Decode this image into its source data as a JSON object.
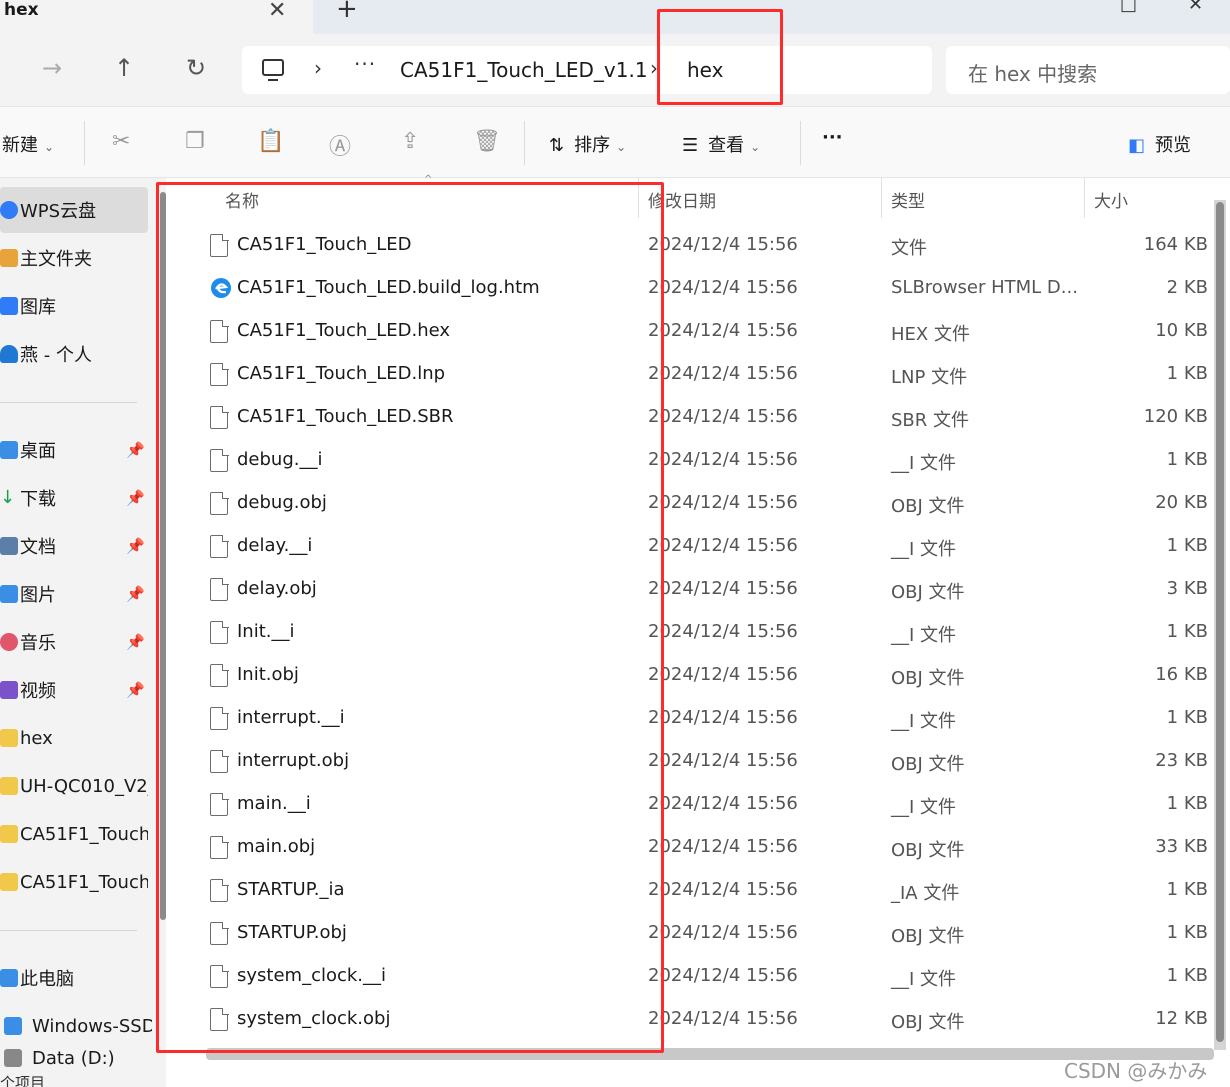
{
  "window": {
    "tab_title": "hex",
    "tab_close": "✕",
    "new_tab": "+",
    "minimize": "—",
    "close": "✕"
  },
  "nav": {
    "back": "←",
    "forward": "→",
    "up": "↑",
    "refresh": "↻"
  },
  "address": {
    "sep": "›",
    "more": "···",
    "segments": [
      "CA51F1_Touch_LED_v1.1",
      "hex"
    ]
  },
  "search": {
    "placeholder": "在 hex 中搜索"
  },
  "toolbar": {
    "new_label": "新建",
    "sort_label": "排序",
    "view_label": "查看",
    "more_label": "···",
    "preview_label": "预览"
  },
  "sidebar": {
    "items": [
      {
        "label": "WPS云盘",
        "icon": "wps-cloud-icon",
        "color": "#2f7cf6"
      },
      {
        "label": "主文件夹",
        "icon": "home-icon",
        "color": "#e8a33a"
      },
      {
        "label": "图库",
        "icon": "gallery-icon",
        "color": "#2f7cf6"
      },
      {
        "label": "燕 - 个人",
        "icon": "onedrive-icon",
        "color": "#1f78d1"
      },
      {
        "label": "桌面",
        "icon": "desktop-icon",
        "color": "#3a8ee6"
      },
      {
        "label": "下载",
        "icon": "download-icon",
        "color": "#17a34a"
      },
      {
        "label": "文档",
        "icon": "documents-icon",
        "color": "#5b7fa8"
      },
      {
        "label": "图片",
        "icon": "pictures-icon",
        "color": "#3a8ee6"
      },
      {
        "label": "音乐",
        "icon": "music-icon",
        "color": "#e0566b"
      },
      {
        "label": "视频",
        "icon": "video-icon",
        "color": "#7b52c9"
      },
      {
        "label": "hex",
        "icon": "folder-icon",
        "color": "#f2c84b"
      },
      {
        "label": "UH-QC010_V2_",
        "icon": "folder-icon",
        "color": "#f2c84b"
      },
      {
        "label": "CA51F1_Touch",
        "icon": "folder-icon",
        "color": "#f2c84b"
      },
      {
        "label": "CA51F1_Touch",
        "icon": "folder-icon",
        "color": "#f2c84b"
      },
      {
        "label": "此电脑",
        "icon": "this-pc-icon",
        "color": "#3a8ee6"
      },
      {
        "label": "Windows-SSD",
        "icon": "drive-icon",
        "color": "#3a8ee6"
      },
      {
        "label": "Data (D:)",
        "icon": "drive-icon",
        "color": "#888888"
      }
    ],
    "pin": "📌"
  },
  "columns": {
    "name": "名称",
    "date": "修改日期",
    "type": "类型",
    "size": "大小"
  },
  "files": [
    {
      "name": "CA51F1_Touch_LED",
      "date": "2024/12/4 15:56",
      "type": "文件",
      "size": "164 KB",
      "icon": "file-icon"
    },
    {
      "name": "CA51F1_Touch_LED.build_log.htm",
      "date": "2024/12/4 15:56",
      "type": "SLBrowser HTML D...",
      "size": "2 KB",
      "icon": "edge-icon"
    },
    {
      "name": "CA51F1_Touch_LED.hex",
      "date": "2024/12/4 15:56",
      "type": "HEX 文件",
      "size": "10 KB",
      "icon": "file-icon"
    },
    {
      "name": "CA51F1_Touch_LED.lnp",
      "date": "2024/12/4 15:56",
      "type": "LNP 文件",
      "size": "1 KB",
      "icon": "file-icon"
    },
    {
      "name": "CA51F1_Touch_LED.SBR",
      "date": "2024/12/4 15:56",
      "type": "SBR 文件",
      "size": "120 KB",
      "icon": "file-icon"
    },
    {
      "name": "debug.__i",
      "date": "2024/12/4 15:56",
      "type": "__I 文件",
      "size": "1 KB",
      "icon": "file-icon"
    },
    {
      "name": "debug.obj",
      "date": "2024/12/4 15:56",
      "type": "OBJ 文件",
      "size": "20 KB",
      "icon": "file-icon"
    },
    {
      "name": "delay.__i",
      "date": "2024/12/4 15:56",
      "type": "__I 文件",
      "size": "1 KB",
      "icon": "file-icon"
    },
    {
      "name": "delay.obj",
      "date": "2024/12/4 15:56",
      "type": "OBJ 文件",
      "size": "3 KB",
      "icon": "file-icon"
    },
    {
      "name": "Init.__i",
      "date": "2024/12/4 15:56",
      "type": "__I 文件",
      "size": "1 KB",
      "icon": "file-icon"
    },
    {
      "name": "Init.obj",
      "date": "2024/12/4 15:56",
      "type": "OBJ 文件",
      "size": "16 KB",
      "icon": "file-icon"
    },
    {
      "name": "interrupt.__i",
      "date": "2024/12/4 15:56",
      "type": "__I 文件",
      "size": "1 KB",
      "icon": "file-icon"
    },
    {
      "name": "interrupt.obj",
      "date": "2024/12/4 15:56",
      "type": "OBJ 文件",
      "size": "23 KB",
      "icon": "file-icon"
    },
    {
      "name": "main.__i",
      "date": "2024/12/4 15:56",
      "type": "__I 文件",
      "size": "1 KB",
      "icon": "file-icon"
    },
    {
      "name": "main.obj",
      "date": "2024/12/4 15:56",
      "type": "OBJ 文件",
      "size": "33 KB",
      "icon": "file-icon"
    },
    {
      "name": "STARTUP._ia",
      "date": "2024/12/4 15:56",
      "type": "_IA 文件",
      "size": "1 KB",
      "icon": "file-icon"
    },
    {
      "name": "STARTUP.obj",
      "date": "2024/12/4 15:56",
      "type": "OBJ 文件",
      "size": "1 KB",
      "icon": "file-icon"
    },
    {
      "name": "system_clock.__i",
      "date": "2024/12/4 15:56",
      "type": "__I 文件",
      "size": "1 KB",
      "icon": "file-icon"
    },
    {
      "name": "system_clock.obj",
      "date": "2024/12/4 15:56",
      "type": "OBJ 文件",
      "size": "12 KB",
      "icon": "file-icon"
    }
  ],
  "status": {
    "text": "个项目"
  },
  "watermark": "CSDN @みかみ",
  "colors": {
    "annotation": "#ff2a2a",
    "accent": "#2f7cf6"
  }
}
